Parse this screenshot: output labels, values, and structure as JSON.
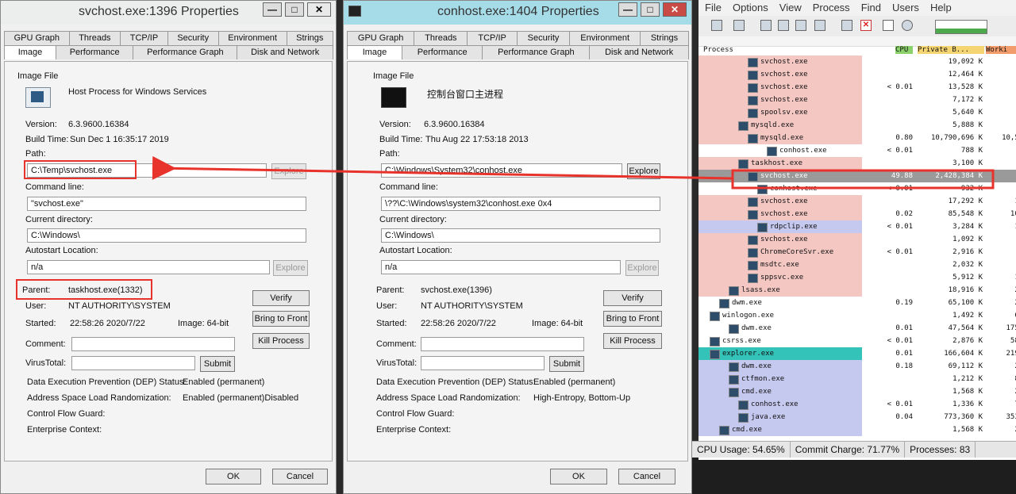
{
  "win1": {
    "title": "svchost.exe:1396 Properties",
    "tabs_row1": [
      "GPU Graph",
      "Threads",
      "TCP/IP",
      "Security",
      "Environment",
      "Strings"
    ],
    "tabs_row2": [
      "Image",
      "Performance",
      "Performance Graph",
      "Disk and Network"
    ],
    "image_file_label": "Image File",
    "description": "Host Process for Windows Services",
    "version_label": "Version:",
    "version": "6.3.9600.16384",
    "build_label": "Build Time:",
    "build": "Sun Dec  1 16:35:17 2019",
    "path_label": "Path:",
    "path": "C:\\Temp\\svchost.exe",
    "explore_label": "Explore",
    "cmd_label": "Command line:",
    "cmd": "\"svchost.exe\"",
    "curdir_label": "Current directory:",
    "curdir": "C:\\Windows\\",
    "autostart_label": "Autostart Location:",
    "autostart": "n/a",
    "explore2_label": "Explore",
    "parent_label": "Parent:",
    "parent": "taskhost.exe(1332)",
    "user_label": "User:",
    "user": "NT AUTHORITY\\SYSTEM",
    "started_label": "Started:",
    "started": "22:58:26  2020/7/22",
    "image_bits": "Image: 64-bit",
    "verify": "Verify",
    "bring": "Bring to Front",
    "kill": "Kill Process",
    "comment_label": "Comment:",
    "virustotal_label": "VirusTotal:",
    "submit": "Submit",
    "dep_label": "Data Execution Prevention (DEP) Status:",
    "dep": "Enabled (permanent)",
    "aslr_label": "Address Space Load Randomization:",
    "aslr": "Enabled (permanent)Disabled",
    "cfg_label": "Control Flow Guard:",
    "ent_label": "Enterprise Context:",
    "ok": "OK",
    "cancel": "Cancel"
  },
  "win2": {
    "title": "conhost.exe:1404 Properties",
    "tabs_row1": [
      "GPU Graph",
      "Threads",
      "TCP/IP",
      "Security",
      "Environment",
      "Strings"
    ],
    "tabs_row2": [
      "Image",
      "Performance",
      "Performance Graph",
      "Disk and Network"
    ],
    "image_file_label": "Image File",
    "description": "控制台窗口主进程",
    "version_label": "Version:",
    "version": "6.3.9600.16384",
    "build_label": "Build Time:",
    "build": "Thu Aug 22 17:53:18 2013",
    "path_label": "Path:",
    "path": "C:\\Windows\\System32\\conhost.exe",
    "explore_label": "Explore",
    "cmd_label": "Command line:",
    "cmd": "\\??\\C:\\Windows\\system32\\conhost.exe 0x4",
    "curdir_label": "Current directory:",
    "curdir": "C:\\Windows\\",
    "autostart_label": "Autostart Location:",
    "autostart": "n/a",
    "explore2_label": "Explore",
    "parent_label": "Parent:",
    "parent": "svchost.exe(1396)",
    "user_label": "User:",
    "user": "NT AUTHORITY\\SYSTEM",
    "started_label": "Started:",
    "started": "22:58:26  2020/7/22",
    "image_bits": "Image: 64-bit",
    "verify": "Verify",
    "bring": "Bring to Front",
    "kill": "Kill Process",
    "comment_label": "Comment:",
    "virustotal_label": "VirusTotal:",
    "submit": "Submit",
    "dep_label": "Data Execution Prevention (DEP) Status:",
    "dep": "Enabled (permanent)",
    "aslr_label": "Address Space Load Randomization:",
    "aslr": "High-Entropy, Bottom-Up",
    "cfg_label": "Control Flow Guard:",
    "ent_label": "Enterprise Context:",
    "ok": "OK",
    "cancel": "Cancel"
  },
  "pe": {
    "menu": [
      "File",
      "Options",
      "View",
      "Process",
      "Find",
      "Users",
      "Help"
    ],
    "columns": [
      "Process",
      "CPU",
      "Private B...",
      "Worki"
    ],
    "status_cpu": "CPU Usage: 54.65%",
    "status_commit": "Commit Charge: 71.77%",
    "status_procs": "Processes: 83",
    "rows": [
      {
        "name": "svchost.exe",
        "cpu": "",
        "priv": "19,092 K",
        "work": "33,",
        "indent": 4,
        "color": "#f4c7c3"
      },
      {
        "name": "svchost.exe",
        "cpu": "",
        "priv": "12,464 K",
        "work": "23,",
        "indent": 4,
        "color": "#f4c7c3"
      },
      {
        "name": "svchost.exe",
        "cpu": "< 0.01",
        "priv": "13,528 K",
        "work": "23,",
        "indent": 4,
        "color": "#f4c7c3"
      },
      {
        "name": "svchost.exe",
        "cpu": "",
        "priv": "7,172 K",
        "work": "11,",
        "indent": 4,
        "color": "#f4c7c3"
      },
      {
        "name": "spoolsv.exe",
        "cpu": "",
        "priv": "5,640 K",
        "work": "13,",
        "indent": 4,
        "color": "#f4c7c3"
      },
      {
        "name": "mysqld.exe",
        "cpu": "",
        "priv": "5,888 K",
        "work": "6,",
        "indent": 3,
        "color": "#f4c7c3"
      },
      {
        "name": "mysqld.exe",
        "cpu": "0.80",
        "priv": "10,790,696 K",
        "work": "10,520,",
        "indent": 4,
        "color": "#f4c7c3"
      },
      {
        "name": "conhost.exe",
        "cpu": "< 0.01",
        "priv": "788 K",
        "work": "3,",
        "indent": 6,
        "color": "#ffffff"
      },
      {
        "name": "taskhost.exe",
        "cpu": "",
        "priv": "3,100 K",
        "work": "6,",
        "indent": 3,
        "color": "#f4c7c3"
      },
      {
        "name": "svchost.exe",
        "cpu": "49.88",
        "priv": "2,428,384 K",
        "work": "11,",
        "indent": 4,
        "color": "#9a9a9a",
        "sel": true
      },
      {
        "name": "conhost.exe",
        "cpu": "< 0.01",
        "priv": "932 K",
        "work": "3,8",
        "indent": 5,
        "color": "#ffffff"
      },
      {
        "name": "svchost.exe",
        "cpu": "",
        "priv": "17,292 K",
        "work": "17,3",
        "indent": 4,
        "color": "#f4c7c3"
      },
      {
        "name": "svchost.exe",
        "cpu": "0.02",
        "priv": "85,548 K",
        "work": "109,4",
        "indent": 4,
        "color": "#f4c7c3"
      },
      {
        "name": "rdpclip.exe",
        "cpu": "< 0.01",
        "priv": "3,284 K",
        "work": "11,2",
        "indent": 5,
        "color": "#c5c8ef"
      },
      {
        "name": "svchost.exe",
        "cpu": "",
        "priv": "1,092 K",
        "work": "4,5",
        "indent": 4,
        "color": "#f4c7c3"
      },
      {
        "name": "ChromeCoreSvr.exe",
        "cpu": "< 0.01",
        "priv": "2,916 K",
        "work": "9,1",
        "indent": 4,
        "color": "#f4c7c3"
      },
      {
        "name": "msdtc.exe",
        "cpu": "",
        "priv": "2,032 K",
        "work": "6,6",
        "indent": 4,
        "color": "#f4c7c3"
      },
      {
        "name": "sppsvc.exe",
        "cpu": "",
        "priv": "5,912 K",
        "work": "11,0",
        "indent": 4,
        "color": "#f4c7c3"
      },
      {
        "name": "lsass.exe",
        "cpu": "",
        "priv": "18,916 K",
        "work": "25,6",
        "indent": 2,
        "color": "#f4c7c3"
      },
      {
        "name": "dwm.exe",
        "cpu": "0.19",
        "priv": "65,100 K",
        "work": "2,03",
        "indent": 1,
        "color": "#ffffff"
      },
      {
        "name": "winlogon.exe",
        "cpu": "",
        "priv": "1,492 K",
        "work": "6,25",
        "indent": 0,
        "color": "#ffffff"
      },
      {
        "name": "dwm.exe",
        "cpu": "0.01",
        "priv": "47,564 K",
        "work": "175,72",
        "indent": 2,
        "color": "#ffffff"
      },
      {
        "name": "csrss.exe",
        "cpu": "< 0.01",
        "priv": "2,876 K",
        "work": "58,92",
        "indent": 0,
        "color": "#ffffff"
      },
      {
        "name": "explorer.exe",
        "cpu": "0.01",
        "priv": "166,604 K",
        "work": "219,01",
        "indent": 0,
        "color": "#34c3b8"
      },
      {
        "name": "dwm.exe",
        "cpu": "0.18",
        "priv": "69,112 K",
        "work": "2,80",
        "indent": 2,
        "color": "#c5c8ef"
      },
      {
        "name": "ctfmon.exe",
        "cpu": "",
        "priv": "1,212 K",
        "work": "8,59",
        "indent": 2,
        "color": "#c5c8ef"
      },
      {
        "name": "cmd.exe",
        "cpu": "",
        "priv": "1,568 K",
        "work": "2,66",
        "indent": 2,
        "color": "#c5c8ef"
      },
      {
        "name": "conhost.exe",
        "cpu": "< 0.01",
        "priv": "1,336 K",
        "work": "7,22",
        "indent": 3,
        "color": "#c5c8ef"
      },
      {
        "name": "java.exe",
        "cpu": "0.04",
        "priv": "773,360 K",
        "work": "353,69",
        "indent": 3,
        "color": "#c5c8ef"
      },
      {
        "name": "cmd.exe",
        "cpu": "",
        "priv": "1,568 K",
        "work": "2,66",
        "indent": 1,
        "color": "#c5c8ef"
      }
    ]
  }
}
